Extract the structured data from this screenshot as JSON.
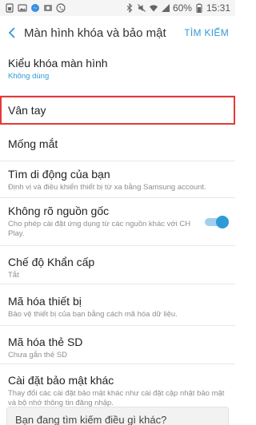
{
  "status": {
    "battery": "60%",
    "time": "15:31",
    "left_icons": [
      "sim-icon",
      "image-icon",
      "messenger-icon",
      "photo-icon",
      "viber-icon"
    ],
    "right_icons": [
      "bluetooth-icon",
      "mute-icon",
      "wifi-icon",
      "signal-icon",
      "battery-icon"
    ]
  },
  "header": {
    "title": "Màn hình khóa và bảo mật",
    "search_label": "TÌM KIẾM"
  },
  "items": [
    {
      "title": "Kiểu khóa màn hình",
      "subtitle": "Không dùng"
    },
    {
      "title": "Vân tay"
    },
    {
      "title": "Mống mắt"
    },
    {
      "title": "Tìm di động của bạn",
      "subtitle": "Định vị và điều khiển thiết bị từ xa bằng Samsung account."
    },
    {
      "title": "Không rõ nguồn gốc",
      "subtitle": "Cho phép cài đặt ứng dụng từ các nguồn khác với CH Play.",
      "toggle": "on"
    },
    {
      "title": "Chế độ Khẩn cấp",
      "subtitle": "Tắt"
    },
    {
      "title": "Mã hóa thiết bị",
      "subtitle": "Bảo vệ thiết bị của bạn bằng cách mã hóa dữ liệu."
    },
    {
      "title": "Mã hóa thẻ SD",
      "subtitle": "Chưa gắn thẻ SD"
    },
    {
      "title": "Cài đặt bảo mật khác",
      "subtitle": "Thay đổi các cài đặt bảo mật khác như cài đặt cập nhật bảo mật và bộ nhớ thông tin đăng nhập."
    }
  ],
  "footer": {
    "prompt": "Bạn đang tìm kiếm điều gì khác?"
  },
  "colors": {
    "accent": "#2f9bd6",
    "highlight": "#e53935"
  }
}
